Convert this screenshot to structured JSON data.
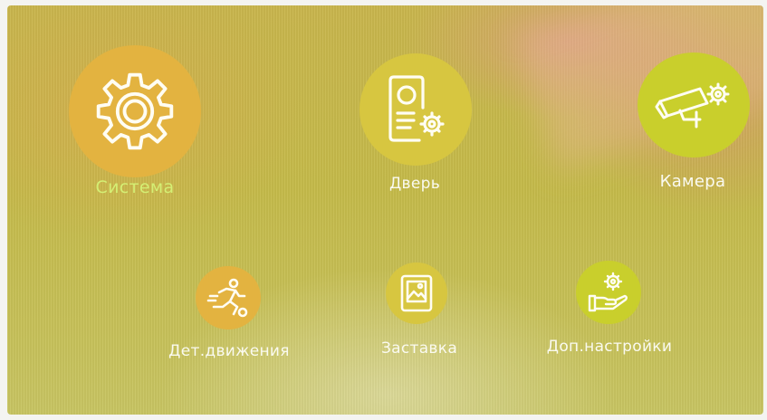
{
  "colors": {
    "circle_orange": "#e3b340",
    "circle_yellow": "#d7c640",
    "circle_yellow_green": "#c9cf2c",
    "label_green": "#d4ef74",
    "label_white": "#fafaf0",
    "icon_white": "#fffdf3"
  },
  "menu": {
    "items": [
      {
        "label": "Система",
        "icon": "gear-icon"
      },
      {
        "label": "Дверь",
        "icon": "door-panel-icon"
      },
      {
        "label": "Камера",
        "icon": "camera-icon"
      },
      {
        "label": "Дет.движения",
        "icon": "running-person-icon"
      },
      {
        "label": "Заставка",
        "icon": "picture-frame-icon"
      },
      {
        "label": "Доп.настройки",
        "icon": "hand-gear-icon"
      }
    ]
  }
}
